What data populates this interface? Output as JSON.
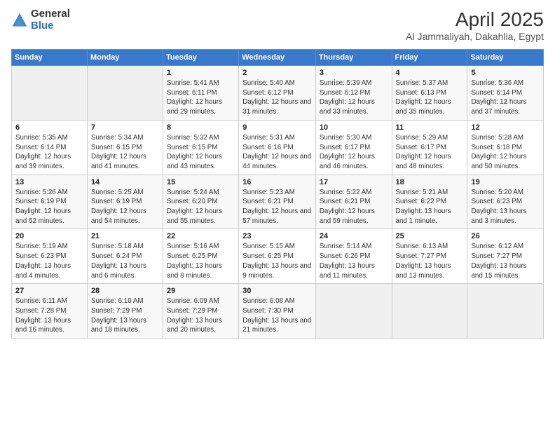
{
  "logo": {
    "general": "General",
    "blue": "Blue"
  },
  "header": {
    "title": "April 2025",
    "subtitle": "Al Jammaliyah, Dakahlia, Egypt"
  },
  "days": [
    "Sunday",
    "Monday",
    "Tuesday",
    "Wednesday",
    "Thursday",
    "Friday",
    "Saturday"
  ],
  "weeks": [
    [
      {
        "day": "",
        "sunrise": "",
        "sunset": "",
        "daylight": ""
      },
      {
        "day": "",
        "sunrise": "",
        "sunset": "",
        "daylight": ""
      },
      {
        "day": "1",
        "sunrise": "Sunrise: 5:41 AM",
        "sunset": "Sunset: 6:11 PM",
        "daylight": "Daylight: 12 hours and 29 minutes."
      },
      {
        "day": "2",
        "sunrise": "Sunrise: 5:40 AM",
        "sunset": "Sunset: 6:12 PM",
        "daylight": "Daylight: 12 hours and 31 minutes."
      },
      {
        "day": "3",
        "sunrise": "Sunrise: 5:39 AM",
        "sunset": "Sunset: 6:12 PM",
        "daylight": "Daylight: 12 hours and 33 minutes."
      },
      {
        "day": "4",
        "sunrise": "Sunrise: 5:37 AM",
        "sunset": "Sunset: 6:13 PM",
        "daylight": "Daylight: 12 hours and 35 minutes."
      },
      {
        "day": "5",
        "sunrise": "Sunrise: 5:36 AM",
        "sunset": "Sunset: 6:14 PM",
        "daylight": "Daylight: 12 hours and 37 minutes."
      }
    ],
    [
      {
        "day": "6",
        "sunrise": "Sunrise: 5:35 AM",
        "sunset": "Sunset: 6:14 PM",
        "daylight": "Daylight: 12 hours and 39 minutes."
      },
      {
        "day": "7",
        "sunrise": "Sunrise: 5:34 AM",
        "sunset": "Sunset: 6:15 PM",
        "daylight": "Daylight: 12 hours and 41 minutes."
      },
      {
        "day": "8",
        "sunrise": "Sunrise: 5:32 AM",
        "sunset": "Sunset: 6:15 PM",
        "daylight": "Daylight: 12 hours and 43 minutes."
      },
      {
        "day": "9",
        "sunrise": "Sunrise: 5:31 AM",
        "sunset": "Sunset: 6:16 PM",
        "daylight": "Daylight: 12 hours and 44 minutes."
      },
      {
        "day": "10",
        "sunrise": "Sunrise: 5:30 AM",
        "sunset": "Sunset: 6:17 PM",
        "daylight": "Daylight: 12 hours and 46 minutes."
      },
      {
        "day": "11",
        "sunrise": "Sunrise: 5:29 AM",
        "sunset": "Sunset: 6:17 PM",
        "daylight": "Daylight: 12 hours and 48 minutes."
      },
      {
        "day": "12",
        "sunrise": "Sunrise: 5:28 AM",
        "sunset": "Sunset: 6:18 PM",
        "daylight": "Daylight: 12 hours and 50 minutes."
      }
    ],
    [
      {
        "day": "13",
        "sunrise": "Sunrise: 5:26 AM",
        "sunset": "Sunset: 6:19 PM",
        "daylight": "Daylight: 12 hours and 52 minutes."
      },
      {
        "day": "14",
        "sunrise": "Sunrise: 5:25 AM",
        "sunset": "Sunset: 6:19 PM",
        "daylight": "Daylight: 12 hours and 54 minutes."
      },
      {
        "day": "15",
        "sunrise": "Sunrise: 5:24 AM",
        "sunset": "Sunset: 6:20 PM",
        "daylight": "Daylight: 12 hours and 55 minutes."
      },
      {
        "day": "16",
        "sunrise": "Sunrise: 5:23 AM",
        "sunset": "Sunset: 6:21 PM",
        "daylight": "Daylight: 12 hours and 57 minutes."
      },
      {
        "day": "17",
        "sunrise": "Sunrise: 5:22 AM",
        "sunset": "Sunset: 6:21 PM",
        "daylight": "Daylight: 12 hours and 59 minutes."
      },
      {
        "day": "18",
        "sunrise": "Sunrise: 5:21 AM",
        "sunset": "Sunset: 6:22 PM",
        "daylight": "Daylight: 13 hours and 1 minute."
      },
      {
        "day": "19",
        "sunrise": "Sunrise: 5:20 AM",
        "sunset": "Sunset: 6:23 PM",
        "daylight": "Daylight: 13 hours and 3 minutes."
      }
    ],
    [
      {
        "day": "20",
        "sunrise": "Sunrise: 5:19 AM",
        "sunset": "Sunset: 6:23 PM",
        "daylight": "Daylight: 13 hours and 4 minutes."
      },
      {
        "day": "21",
        "sunrise": "Sunrise: 5:18 AM",
        "sunset": "Sunset: 6:24 PM",
        "daylight": "Daylight: 13 hours and 6 minutes."
      },
      {
        "day": "22",
        "sunrise": "Sunrise: 5:16 AM",
        "sunset": "Sunset: 6:25 PM",
        "daylight": "Daylight: 13 hours and 8 minutes."
      },
      {
        "day": "23",
        "sunrise": "Sunrise: 5:15 AM",
        "sunset": "Sunset: 6:25 PM",
        "daylight": "Daylight: 13 hours and 9 minutes."
      },
      {
        "day": "24",
        "sunrise": "Sunrise: 5:14 AM",
        "sunset": "Sunset: 6:26 PM",
        "daylight": "Daylight: 13 hours and 11 minutes."
      },
      {
        "day": "25",
        "sunrise": "Sunrise: 6:13 AM",
        "sunset": "Sunset: 7:27 PM",
        "daylight": "Daylight: 13 hours and 13 minutes."
      },
      {
        "day": "26",
        "sunrise": "Sunrise: 6:12 AM",
        "sunset": "Sunset: 7:27 PM",
        "daylight": "Daylight: 13 hours and 15 minutes."
      }
    ],
    [
      {
        "day": "27",
        "sunrise": "Sunrise: 6:11 AM",
        "sunset": "Sunset: 7:28 PM",
        "daylight": "Daylight: 13 hours and 16 minutes."
      },
      {
        "day": "28",
        "sunrise": "Sunrise: 6:10 AM",
        "sunset": "Sunset: 7:29 PM",
        "daylight": "Daylight: 13 hours and 18 minutes."
      },
      {
        "day": "29",
        "sunrise": "Sunrise: 6:09 AM",
        "sunset": "Sunset: 7:29 PM",
        "daylight": "Daylight: 13 hours and 20 minutes."
      },
      {
        "day": "30",
        "sunrise": "Sunrise: 6:08 AM",
        "sunset": "Sunset: 7:30 PM",
        "daylight": "Daylight: 13 hours and 21 minutes."
      },
      {
        "day": "",
        "sunrise": "",
        "sunset": "",
        "daylight": ""
      },
      {
        "day": "",
        "sunrise": "",
        "sunset": "",
        "daylight": ""
      },
      {
        "day": "",
        "sunrise": "",
        "sunset": "",
        "daylight": ""
      }
    ]
  ]
}
